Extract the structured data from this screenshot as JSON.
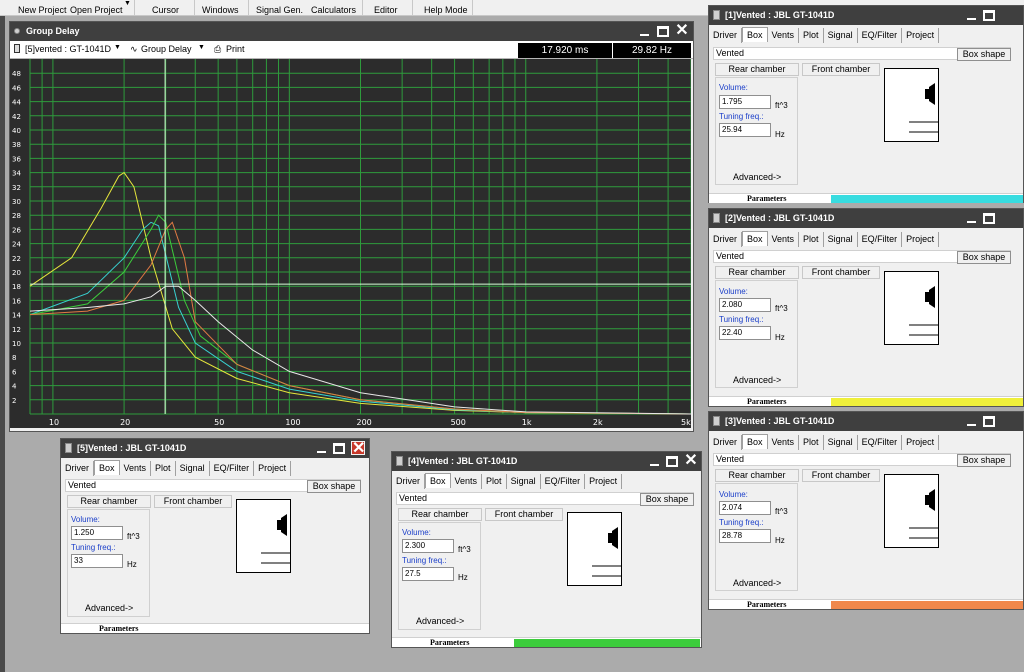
{
  "toolbar": {
    "items": [
      "New Project",
      "Open Project",
      "Cursor",
      "Windows",
      "Signal Gen.",
      "Calculators",
      "Editor",
      "Help Mode"
    ]
  },
  "group_delay": {
    "title": "Group Delay",
    "selector_project": "[5]vented : GT-1041D",
    "selector_plot": "Group Delay",
    "print_label": "Print",
    "time_readout": "17.920 ms",
    "freq_readout": "29.82 Hz",
    "plot_bg": "#2c2c2c",
    "grid_color": "#2e9b3c"
  },
  "chart_data": {
    "type": "line",
    "xscale": "log",
    "xlim": [
      8,
      5000
    ],
    "ylim": [
      0,
      50
    ],
    "grid": true,
    "yticks": [
      "48",
      "46",
      "44",
      "42",
      "40",
      "38",
      "36",
      "34",
      "32",
      "30",
      "28",
      "26",
      "24",
      "22",
      "20",
      "18",
      "16",
      "14",
      "12",
      "10",
      "8",
      "6",
      "4",
      "2"
    ],
    "xticks": [
      "10",
      "20",
      "50",
      "100",
      "200",
      "500",
      "1k",
      "2k",
      "5k"
    ],
    "cursor": {
      "x": 29.82,
      "y": 18.3
    },
    "series": [
      {
        "color": "#e6e63c",
        "x": [
          8,
          12,
          16,
          19,
          20,
          22,
          26,
          32,
          40,
          60,
          100,
          200,
          500,
          1000,
          5000
        ],
        "y": [
          18,
          22,
          29,
          33.5,
          34,
          32,
          22,
          12,
          8,
          5,
          3,
          1.5,
          0.5,
          0.2,
          0
        ]
      },
      {
        "color": "#38d1d1",
        "x": [
          8,
          14,
          20,
          24,
          26,
          28,
          34,
          40,
          60,
          100,
          200,
          500,
          1000,
          5000
        ],
        "y": [
          14,
          17,
          22,
          26,
          27,
          26.5,
          15,
          10,
          6,
          3.5,
          1.8,
          0.6,
          0.2,
          0
        ]
      },
      {
        "color": "#3ccc3c",
        "x": [
          8,
          14,
          20,
          26,
          28,
          30,
          36,
          42,
          60,
          100,
          200,
          500,
          1000,
          5000
        ],
        "y": [
          14,
          15.5,
          20,
          26,
          28,
          27,
          16,
          11,
          7,
          4,
          2,
          0.7,
          0.2,
          0
        ]
      },
      {
        "color": "#e07a44",
        "x": [
          8,
          14,
          20,
          26,
          30,
          32,
          36,
          40,
          60,
          100,
          200,
          500,
          1000,
          5000
        ],
        "y": [
          14,
          14.5,
          16,
          21,
          26,
          27,
          22,
          13,
          7,
          4,
          2,
          0.7,
          0.2,
          0
        ]
      },
      {
        "color": "#e8e8e8",
        "x": [
          8,
          14,
          20,
          26,
          30,
          34,
          40,
          50,
          70,
          100,
          200,
          500,
          1000,
          5000
        ],
        "y": [
          14.5,
          15,
          15.5,
          16.5,
          18,
          18,
          16,
          13,
          9,
          6,
          3,
          1,
          0.3,
          0
        ]
      }
    ]
  },
  "panels": {
    "p1": {
      "title": "[1]Vented : JBL GT-1041D",
      "tabs": [
        "Driver",
        "Box",
        "Vents",
        "Plot",
        "Signal",
        "EQ/Filter",
        "Project"
      ],
      "vented": "Vented",
      "box_shape": "Box shape",
      "rear": "Rear chamber",
      "front": "Front chamber",
      "volume_label": "Volume:",
      "volume": "1.795",
      "volume_unit": "ft^3",
      "tuning_label": "Tuning freq.:",
      "tuning": "25.94",
      "tuning_unit": "Hz",
      "advanced": "Advanced->",
      "params": "Parameters",
      "color": "#38dce0"
    },
    "p2": {
      "title": "[2]Vented : JBL GT-1041D",
      "tabs": [
        "Driver",
        "Box",
        "Vents",
        "Plot",
        "Signal",
        "EQ/Filter",
        "Project"
      ],
      "vented": "Vented",
      "box_shape": "Box shape",
      "rear": "Rear chamber",
      "front": "Front chamber",
      "volume_label": "Volume:",
      "volume": "2.080",
      "volume_unit": "ft^3",
      "tuning_label": "Tuning freq.:",
      "tuning": "22.40",
      "tuning_unit": "Hz",
      "advanced": "Advanced->",
      "params": "Parameters",
      "color": "#f0f03a"
    },
    "p3": {
      "title": "[3]Vented : JBL GT-1041D",
      "tabs": [
        "Driver",
        "Box",
        "Vents",
        "Plot",
        "Signal",
        "EQ/Filter",
        "Project"
      ],
      "vented": "Vented",
      "box_shape": "Box shape",
      "rear": "Rear chamber",
      "front": "Front chamber",
      "volume_label": "Volume:",
      "volume": "2.074",
      "volume_unit": "ft^3",
      "tuning_label": "Tuning freq.:",
      "tuning": "28.78",
      "tuning_unit": "Hz",
      "advanced": "Advanced->",
      "params": "Parameters",
      "color": "#f0884c"
    },
    "p4": {
      "title": "[4]Vented : JBL GT-1041D",
      "tabs": [
        "Driver",
        "Box",
        "Vents",
        "Plot",
        "Signal",
        "EQ/Filter",
        "Project"
      ],
      "vented": "Vented",
      "box_shape": "Box shape",
      "rear": "Rear chamber",
      "front": "Front chamber",
      "volume_label": "Volume:",
      "volume": "2.300",
      "volume_unit": "ft^3",
      "tuning_label": "Tuning freq.:",
      "tuning": "27.5",
      "tuning_unit": "Hz",
      "advanced": "Advanced->",
      "params": "Parameters",
      "color": "#3ccc3c"
    },
    "p5": {
      "title": "[5]Vented : JBL GT-1041D",
      "tabs": [
        "Driver",
        "Box",
        "Vents",
        "Plot",
        "Signal",
        "EQ/Filter",
        "Project"
      ],
      "vented": "Vented",
      "box_shape": "Box shape",
      "rear": "Rear chamber",
      "front": "Front chamber",
      "volume_label": "Volume:",
      "volume": "1.250",
      "volume_unit": "ft^3",
      "tuning_label": "Tuning freq.:",
      "tuning": "33",
      "tuning_unit": "Hz",
      "advanced": "Advanced->",
      "params": "Parameters",
      "color": "#ffffff"
    }
  }
}
